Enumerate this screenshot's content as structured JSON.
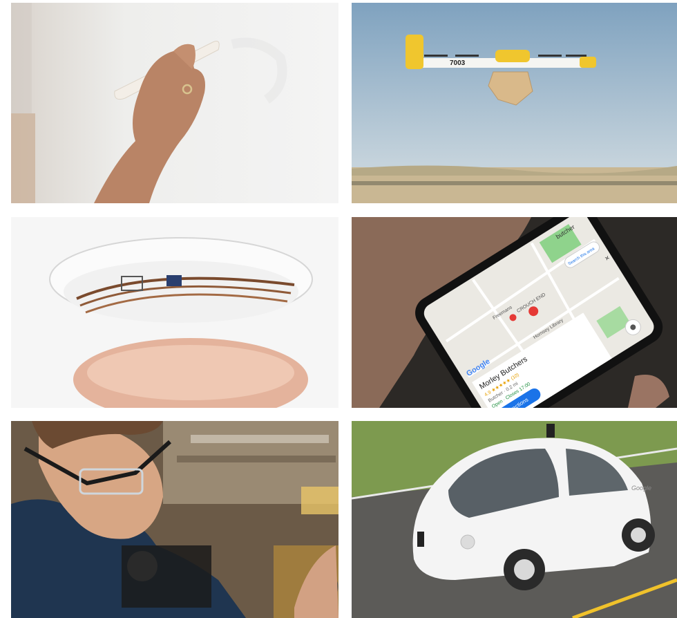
{
  "tiles": {
    "stylus": {
      "icon": "hand-stylus-photo"
    },
    "drone": {
      "icon": "delivery-drone-photo",
      "drone_number": "7003"
    },
    "contact_lens": {
      "icon": "smart-contact-lens-photo"
    },
    "maps_phone": {
      "icon": "phone-maps-photo",
      "search_query": "butcher",
      "search_area_button": "Search this area",
      "close_symbol": "×",
      "brand": "Google",
      "place_name": "Morley Butchers",
      "rating_line": "4.9 ★★★★★ (10)",
      "category_line": "Butcher · 0.2 mi",
      "hours_line": "Open · Closes 17:00",
      "directions_button": "Directions",
      "street_labels": [
        "CROUCH END",
        "Freemans",
        "Hornsey Library"
      ]
    },
    "smart_glasses": {
      "icon": "smart-glasses-worker-photo"
    },
    "self_driving_car": {
      "icon": "self-driving-car-photo",
      "car_logo": "Google"
    }
  }
}
